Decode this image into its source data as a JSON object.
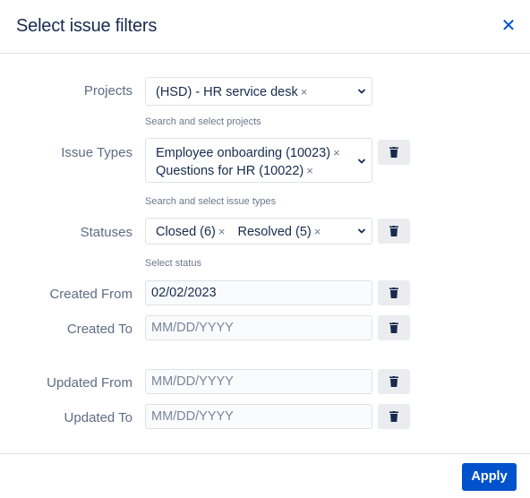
{
  "dialog": {
    "title": "Select issue filters",
    "apply_label": "Apply"
  },
  "projects": {
    "label": "Projects",
    "selected": [
      "(HSD) - HR service desk"
    ],
    "helper": "Search and select projects"
  },
  "issue_types": {
    "label": "Issue Types",
    "selected": [
      "Employee onboarding (10023)",
      "Questions for HR (10022)"
    ],
    "helper": "Search and select issue types"
  },
  "statuses": {
    "label": "Statuses",
    "selected": [
      "Closed (6)",
      "Resolved (5)"
    ],
    "helper": "Select status"
  },
  "created_from": {
    "label": "Created From",
    "value": "02/02/2023"
  },
  "created_to": {
    "label": "Created To",
    "value": "",
    "placeholder": "MM/DD/YYYY"
  },
  "updated_from": {
    "label": "Updated From",
    "value": "",
    "placeholder": "MM/DD/YYYY"
  },
  "updated_to": {
    "label": "Updated To",
    "value": "",
    "placeholder": "MM/DD/YYYY"
  },
  "icons": {
    "remove_chip": "×",
    "close": "close-icon",
    "trash": "trash-icon",
    "chevron": "chevron-down-icon"
  },
  "colors": {
    "accent": "#0052cc",
    "label": "#5e6c84",
    "border": "#dfe1e6",
    "trash_bg": "#ebecf0"
  }
}
